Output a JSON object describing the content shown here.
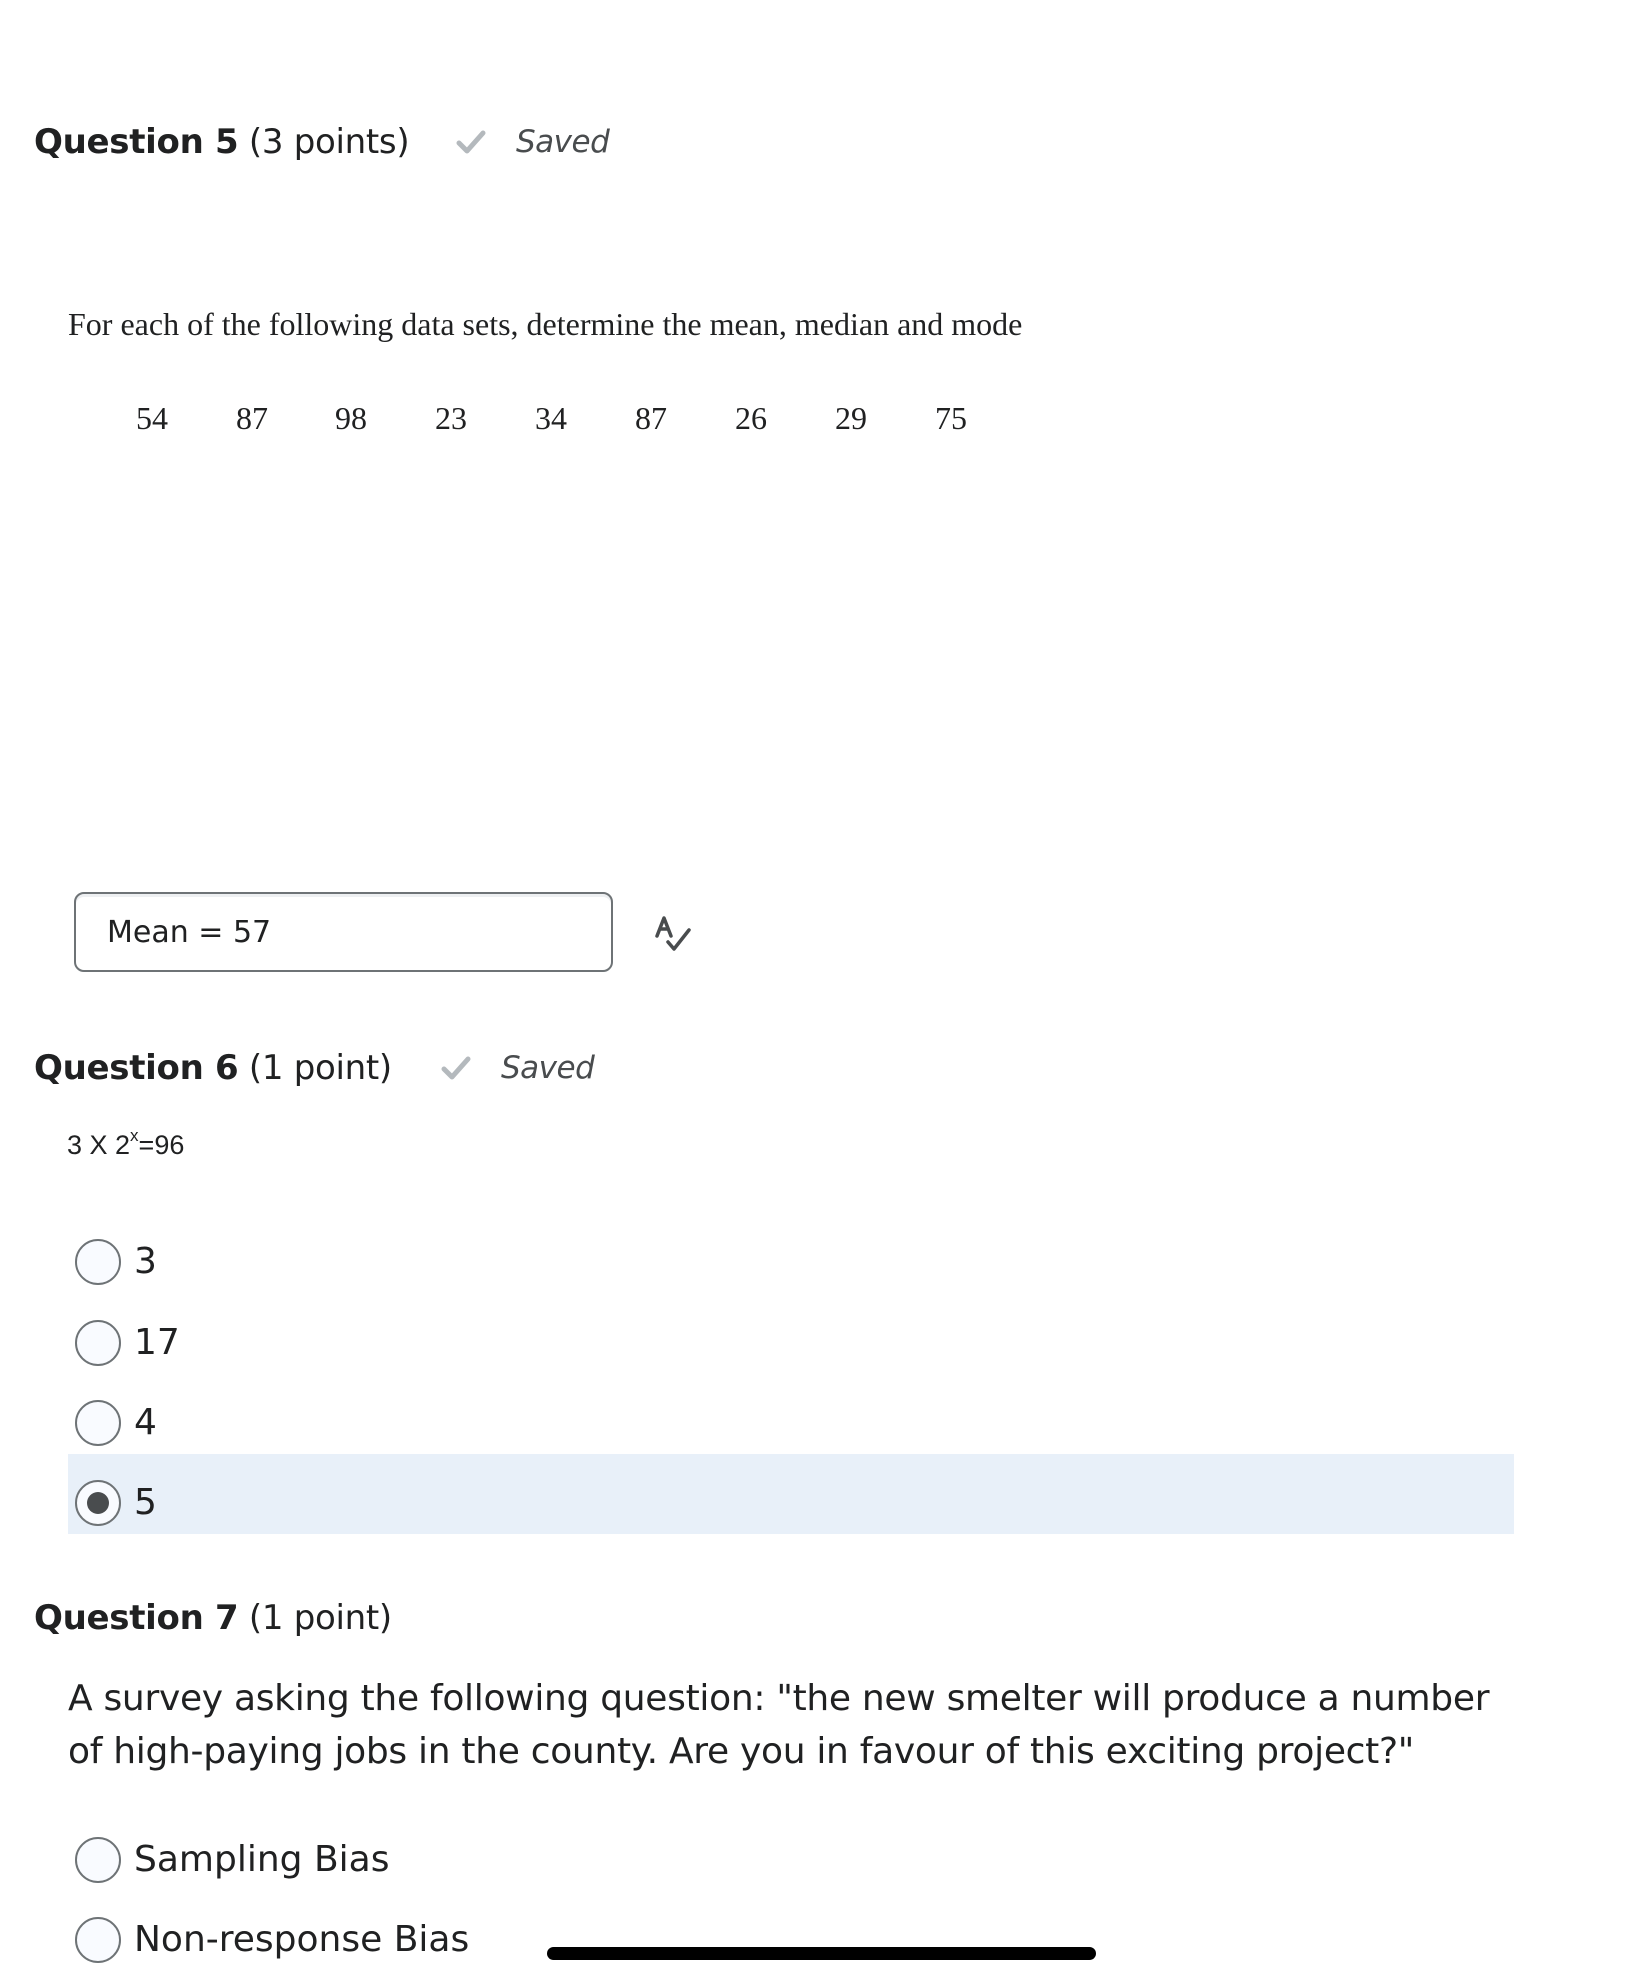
{
  "questions": [
    {
      "number_label": "Question 5",
      "points_label": "(3 points)",
      "status": {
        "icon": "check-icon",
        "label": "Saved"
      },
      "instruction": "For each of the following data sets, determine the mean, median and mode",
      "data_set": [
        "54",
        "87",
        "98",
        "23",
        "34",
        "87",
        "26",
        "29",
        "75"
      ],
      "answer": {
        "value": "Mean = 57",
        "placeholder": ""
      },
      "spellcheck_icon": "spellcheck-icon"
    },
    {
      "number_label": "Question 6",
      "points_label": "(1 point)",
      "status": {
        "icon": "check-icon",
        "label": "Saved"
      },
      "formula": {
        "base": "3 X 2",
        "exponent": "x",
        "rest": "=96"
      },
      "options": [
        {
          "label": "3",
          "selected": false
        },
        {
          "label": "17",
          "selected": false
        },
        {
          "label": "4",
          "selected": false
        },
        {
          "label": "5",
          "selected": true
        }
      ]
    },
    {
      "number_label": "Question 7",
      "points_label": "(1 point)",
      "prompt": "A survey asking the following question: \"the new smelter will produce a number of high-paying jobs in the county. Are you in favour of this exciting project?\"",
      "options": [
        {
          "label": "Sampling Bias",
          "selected": false
        },
        {
          "label": "Non-response Bias",
          "selected": false
        }
      ]
    }
  ],
  "colors": {
    "selected_row": "#e8f0f9",
    "check": "#b4b9bd",
    "text": "#202122"
  }
}
